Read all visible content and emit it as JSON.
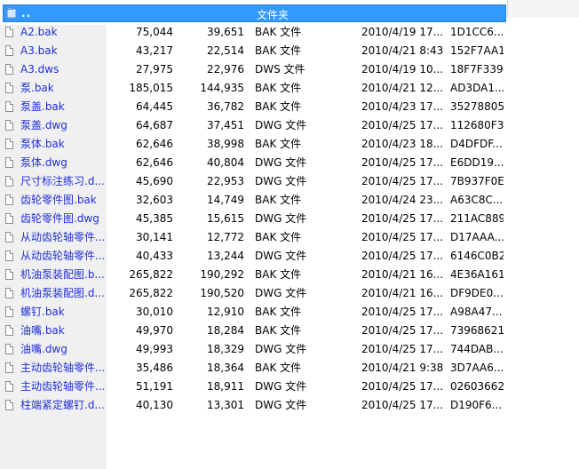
{
  "parent_row": {
    "name": "..",
    "type": "文件夹"
  },
  "files": [
    {
      "name": "A2.bak",
      "size": "75,044",
      "packed": "39,651",
      "type": "BAK 文件",
      "modified": "2010/4/19 17...",
      "crc": "1D1CC6..."
    },
    {
      "name": "A3.bak",
      "size": "43,217",
      "packed": "22,514",
      "type": "BAK 文件",
      "modified": "2010/4/21 8:43",
      "crc": "152F7AA1"
    },
    {
      "name": "A3.dws",
      "size": "27,975",
      "packed": "22,976",
      "type": "DWS 文件",
      "modified": "2010/4/19 10...",
      "crc": "18F7F339"
    },
    {
      "name": "泵.bak",
      "size": "185,015",
      "packed": "144,935",
      "type": "BAK 文件",
      "modified": "2010/4/21 12...",
      "crc": "AD3DA1..."
    },
    {
      "name": "泵盖.bak",
      "size": "64,445",
      "packed": "36,782",
      "type": "BAK 文件",
      "modified": "2010/4/23 17...",
      "crc": "35278805"
    },
    {
      "name": "泵盖.dwg",
      "size": "64,687",
      "packed": "37,451",
      "type": "DWG 文件",
      "modified": "2010/4/25 17...",
      "crc": "112680F3"
    },
    {
      "name": "泵体.bak",
      "size": "62,646",
      "packed": "38,998",
      "type": "BAK 文件",
      "modified": "2010/4/23 18...",
      "crc": "D4DFDF..."
    },
    {
      "name": "泵体.dwg",
      "size": "62,646",
      "packed": "40,804",
      "type": "DWG 文件",
      "modified": "2010/4/25 17...",
      "crc": "E6DD19..."
    },
    {
      "name": "尺寸标注练习.d...",
      "size": "45,690",
      "packed": "22,953",
      "type": "DWG 文件",
      "modified": "2010/4/25 17...",
      "crc": "7B937F0E"
    },
    {
      "name": "齿轮零件图.bak",
      "size": "32,603",
      "packed": "14,749",
      "type": "BAK 文件",
      "modified": "2010/4/24 23...",
      "crc": "A63C8C..."
    },
    {
      "name": "齿轮零件图.dwg",
      "size": "45,385",
      "packed": "15,615",
      "type": "DWG 文件",
      "modified": "2010/4/25 17...",
      "crc": "211AC889"
    },
    {
      "name": "从动齿轮轴零件...",
      "size": "30,141",
      "packed": "12,772",
      "type": "BAK 文件",
      "modified": "2010/4/25 17...",
      "crc": "D17AAA..."
    },
    {
      "name": "从动齿轮轴零件...",
      "size": "40,433",
      "packed": "13,244",
      "type": "DWG 文件",
      "modified": "2010/4/25 17...",
      "crc": "6146C0B2"
    },
    {
      "name": "机油泵装配图.b...",
      "size": "265,822",
      "packed": "190,292",
      "type": "BAK 文件",
      "modified": "2010/4/21 16...",
      "crc": "4E36A161"
    },
    {
      "name": "机油泵装配图.d...",
      "size": "265,822",
      "packed": "190,520",
      "type": "DWG 文件",
      "modified": "2010/4/21 16...",
      "crc": "DF9DE0..."
    },
    {
      "name": "螺钉.bak",
      "size": "30,010",
      "packed": "12,910",
      "type": "BAK 文件",
      "modified": "2010/4/25 17...",
      "crc": "A98A47..."
    },
    {
      "name": "油嘴.bak",
      "size": "49,970",
      "packed": "18,284",
      "type": "BAK 文件",
      "modified": "2010/4/25 17...",
      "crc": "73968621"
    },
    {
      "name": "油嘴.dwg",
      "size": "49,993",
      "packed": "18,329",
      "type": "DWG 文件",
      "modified": "2010/4/25 17...",
      "crc": "744DAB..."
    },
    {
      "name": "主动齿轮轴零件...",
      "size": "35,486",
      "packed": "18,364",
      "type": "BAK 文件",
      "modified": "2010/4/21 9:38",
      "crc": "3D7AA6..."
    },
    {
      "name": "主动齿轮轴零件...",
      "size": "51,191",
      "packed": "18,911",
      "type": "DWG 文件",
      "modified": "2010/4/25 17...",
      "crc": "02603662"
    },
    {
      "name": "柱端紧定螺钉.d...",
      "size": "40,130",
      "packed": "13,301",
      "type": "DWG 文件",
      "modified": "2010/4/25 17...",
      "crc": "D190F6..."
    }
  ],
  "colors": {
    "selection": "#3399ff",
    "file_name": "#1f2fd6",
    "name_column_bg": "#f0f0f0"
  },
  "icons": {
    "parent_folder": "folder-up-icon",
    "file": "file-icon"
  }
}
